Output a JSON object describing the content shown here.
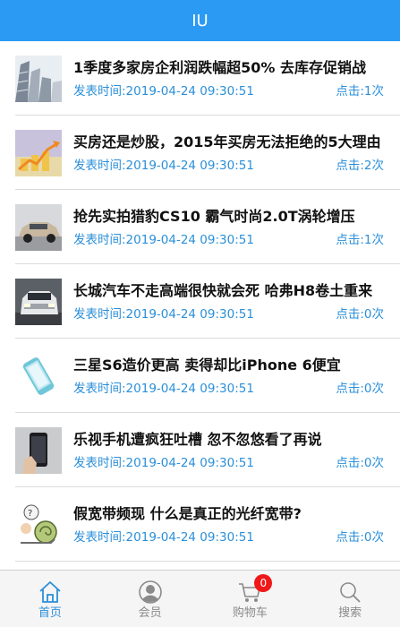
{
  "header": {
    "title": "IU"
  },
  "news": [
    {
      "title": "1季度多家房企利润跌幅超50% 去库存促销战",
      "time": "发表时间:2019-04-24 09:30:51",
      "clicks": "点击:1次",
      "thumb_icon": "buildings-thumbnail"
    },
    {
      "title": "买房还是炒股，2015年买房无法拒绝的5大理由",
      "time": "发表时间:2019-04-24 09:30:51",
      "clicks": "点击:2次",
      "thumb_icon": "chart-arrow-thumbnail"
    },
    {
      "title": "抢先实拍猎豹CS10 霸气时尚2.0T涡轮增压",
      "time": "发表时间:2019-04-24 09:30:51",
      "clicks": "点击:1次",
      "thumb_icon": "suv-car-thumbnail"
    },
    {
      "title": "长城汽车不走高端很快就会死 哈弗H8卷土重来",
      "time": "发表时间:2019-04-24 09:30:51",
      "clicks": "点击:0次",
      "thumb_icon": "suv-front-thumbnail"
    },
    {
      "title": "三星S6造价更高 卖得却比iPhone 6便宜",
      "time": "发表时间:2019-04-24 09:30:51",
      "clicks": "点击:0次",
      "thumb_icon": "smartphone-thumbnail"
    },
    {
      "title": "乐视手机遭疯狂吐槽 忽不忽悠看了再说",
      "time": "发表时间:2019-04-24 09:30:51",
      "clicks": "点击:0次",
      "thumb_icon": "phone-hand-thumbnail"
    },
    {
      "title": "假宽带频现 什么是真正的光纤宽带?",
      "time": "发表时间:2019-04-24 09:30:51",
      "clicks": "点击:0次",
      "thumb_icon": "cartoon-snail-thumbnail"
    }
  ],
  "tabbar": {
    "home": "首页",
    "member": "会员",
    "cart": "购物车",
    "cart_badge": "0",
    "search": "搜索"
  },
  "colors": {
    "accent": "#2b9af3",
    "badge": "#f01818"
  }
}
